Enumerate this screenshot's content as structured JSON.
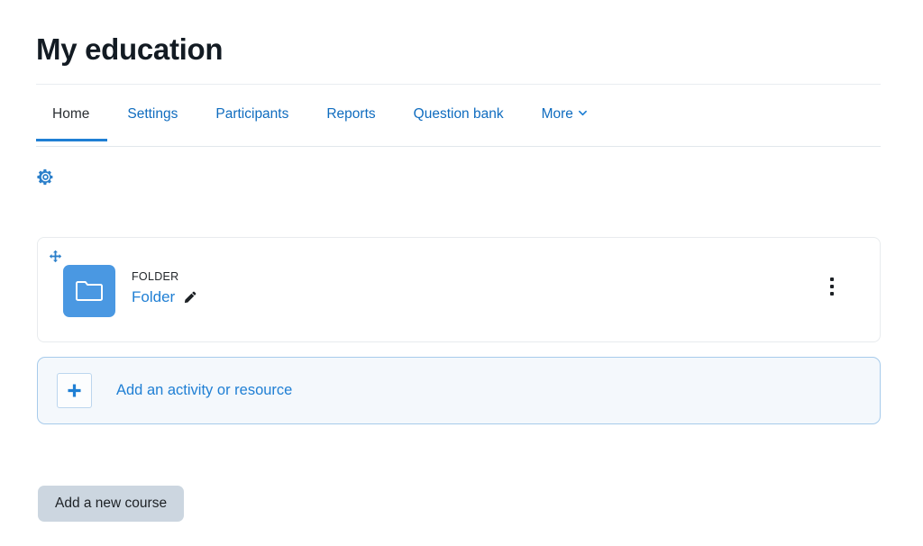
{
  "header": {
    "title": "My education"
  },
  "tabs": [
    {
      "label": "Home",
      "active": true,
      "icon": ""
    },
    {
      "label": "Settings",
      "active": false,
      "icon": ""
    },
    {
      "label": "Participants",
      "active": false,
      "icon": ""
    },
    {
      "label": "Reports",
      "active": false,
      "icon": ""
    },
    {
      "label": "Question bank",
      "active": false,
      "icon": ""
    },
    {
      "label": "More",
      "active": false,
      "icon": "chevron-down-icon"
    }
  ],
  "toolbar": {
    "gear_icon": "gear-icon"
  },
  "activity": {
    "move_icon": "move-arrows-icon",
    "tile_icon": "folder-icon",
    "type_label": "FOLDER",
    "name": "Folder",
    "edit_icon": "pencil-icon",
    "menu_icon": "kebab-menu-icon"
  },
  "add_activity": {
    "plus_icon": "plus-icon",
    "label": "Add an activity or resource"
  },
  "footer": {
    "add_course_label": "Add a new course"
  },
  "colors": {
    "link_blue": "#1f7fd4",
    "tile_blue": "#4a98e2",
    "add_box_bg": "#f4f8fc",
    "add_box_border": "#a7cbeb",
    "button_bg": "#ccd6e0",
    "heading": "#131b23"
  }
}
